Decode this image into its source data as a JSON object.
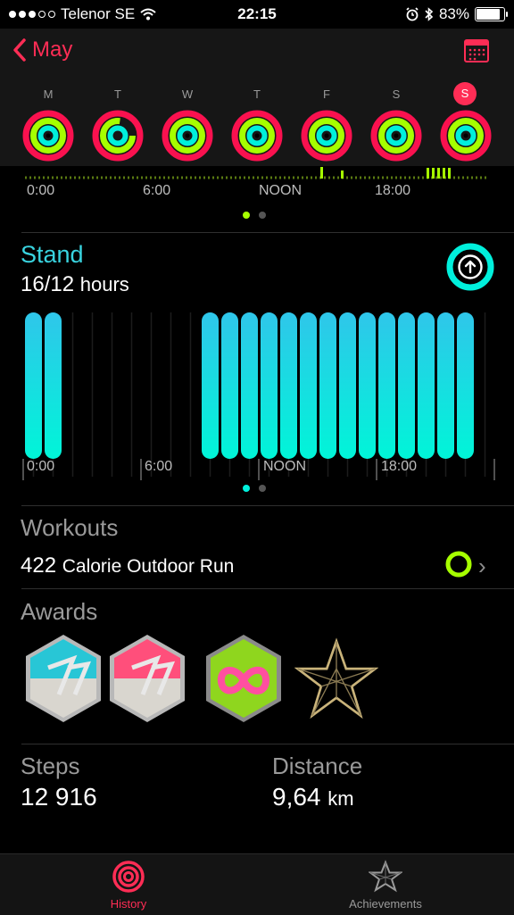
{
  "status_bar": {
    "carrier": "Telenor SE",
    "time": "22:15",
    "battery": "83%"
  },
  "header": {
    "back_label": "May",
    "days": [
      {
        "letter": "M"
      },
      {
        "letter": "T"
      },
      {
        "letter": "W"
      },
      {
        "letter": "T"
      },
      {
        "letter": "F"
      },
      {
        "letter": "S"
      },
      {
        "letter": "S",
        "selected": true
      }
    ]
  },
  "timeline": {
    "ticks": [
      "0:00",
      "6:00",
      "NOON",
      "18:00"
    ]
  },
  "stand": {
    "title": "Stand",
    "value": "16/12",
    "unit": "hours"
  },
  "chart_data": {
    "type": "bar",
    "categories": [
      "0",
      "1",
      "2",
      "3",
      "4",
      "5",
      "6",
      "7",
      "8",
      "9",
      "10",
      "11",
      "12",
      "13",
      "14",
      "15",
      "16",
      "17",
      "18",
      "19",
      "20",
      "21",
      "22",
      "23"
    ],
    "values": [
      1,
      1,
      0,
      0,
      0,
      0,
      0,
      0,
      0,
      1,
      1,
      1,
      1,
      1,
      1,
      1,
      1,
      1,
      1,
      1,
      1,
      1,
      1,
      0
    ],
    "x_tick_labels": [
      "0:00",
      "6:00",
      "NOON",
      "18:00"
    ],
    "ylim": [
      0,
      1
    ]
  },
  "workouts": {
    "title": "Workouts",
    "entry_value": "422",
    "entry_label": "Calorie Outdoor Run"
  },
  "awards": {
    "title": "Awards"
  },
  "steps": {
    "title": "Steps",
    "value": "12 916"
  },
  "distance": {
    "title": "Distance",
    "value": "9,64",
    "unit": "km"
  },
  "tabs": {
    "history": "History",
    "achievements": "Achievements"
  },
  "colors": {
    "accent": "#ff2d55",
    "move": "#fa114f",
    "exercise": "#a6ff00",
    "stand": "#00f0dc"
  }
}
